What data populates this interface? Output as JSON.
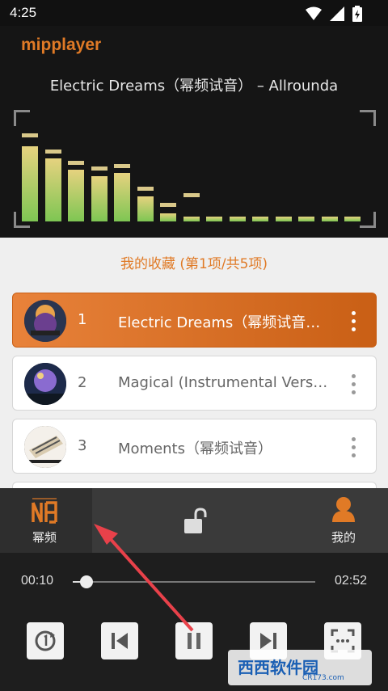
{
  "status_bar": {
    "time": "4:25",
    "icons": [
      "wifi-icon",
      "signal-icon",
      "battery-charging-icon"
    ]
  },
  "app": {
    "title": "mipplayer",
    "accent": "#e07a26"
  },
  "now_playing": "Electric Dreams（幂频试音） – Allrounda",
  "spectrum": {
    "levels": [
      0.73,
      0.61,
      0.5,
      0.44,
      0.47,
      0.24,
      0.08,
      0.01,
      0.05,
      0.05,
      0.05,
      0.05,
      0.05,
      0.05,
      0.05
    ],
    "peaks": [
      0.79,
      0.63,
      0.52,
      0.47,
      0.49,
      0.27,
      0.12,
      0.21,
      0.0,
      0.0,
      0.0,
      0.0,
      0.0,
      0.0,
      0.0
    ]
  },
  "favorites_title": "我的收藏 (第1项/共5项)",
  "tracks": [
    {
      "num": "1",
      "name": "Electric Dreams（幂频试音…",
      "active": true
    },
    {
      "num": "2",
      "name": "Magical (Instrumental Vers…",
      "active": false
    },
    {
      "num": "3",
      "name": "Moments（幂频试音）",
      "active": false
    }
  ],
  "bottom_nav": {
    "mupin": "幂频",
    "mine": "我的"
  },
  "player": {
    "current_time": "00:10",
    "total_time": "02:52",
    "progress": 0.058
  },
  "watermark": {
    "main": "西西软件园",
    "sub": "CR173.com"
  },
  "colors": {
    "active_track_start": "#e8823a",
    "active_track_end": "#c95f15",
    "arrow": "#e8414a"
  }
}
